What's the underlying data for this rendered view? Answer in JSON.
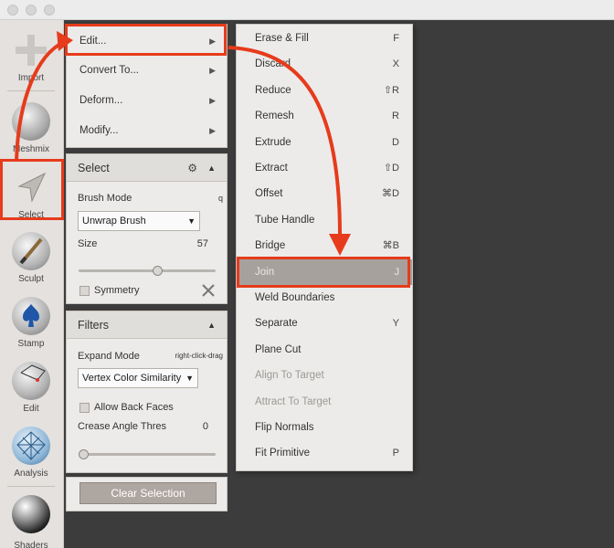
{
  "toolbar": {
    "tools": [
      {
        "label": "Import",
        "icon": "plus-icon"
      },
      {
        "label": "Meshmix",
        "icon": "meshmix-bust-icon"
      },
      {
        "label": "Select",
        "icon": "select-arrow-icon"
      },
      {
        "label": "Sculpt",
        "icon": "sculpt-brush-icon"
      },
      {
        "label": "Stamp",
        "icon": "stamp-icon"
      },
      {
        "label": "Edit",
        "icon": "edit-sphere-icon"
      },
      {
        "label": "Analysis",
        "icon": "analysis-mesh-icon"
      },
      {
        "label": "Shaders",
        "icon": "shaders-sphere-icon"
      }
    ]
  },
  "main_menu": {
    "items": [
      {
        "label": "Edit..."
      },
      {
        "label": "Convert To..."
      },
      {
        "label": "Deform..."
      },
      {
        "label": "Modify..."
      }
    ]
  },
  "select_panel": {
    "title": "Select",
    "brush_mode_label": "Brush Mode",
    "brush_mode_hint": "q",
    "brush_mode_value": "Unwrap Brush",
    "size_label": "Size",
    "size_value": "57",
    "size_fraction": 0.57,
    "symmetry_label": "Symmetry"
  },
  "filters_panel": {
    "title": "Filters",
    "expand_mode_label": "Expand Mode",
    "expand_mode_hint": "right-click-drag",
    "expand_mode_value": "Vertex Color Similarity",
    "allow_back_faces_label": "Allow Back Faces",
    "crease_label": "Crease Angle Thres",
    "crease_value": "0",
    "crease_fraction": 0.0
  },
  "clear_selection_label": "Clear Selection",
  "edit_submenu": {
    "items": [
      {
        "label": "Erase & Fill",
        "shortcut": "F",
        "state": "normal"
      },
      {
        "label": "Discard",
        "shortcut": "X",
        "state": "normal"
      },
      {
        "label": "Reduce",
        "shortcut": "⇧R",
        "state": "normal"
      },
      {
        "label": "Remesh",
        "shortcut": "R",
        "state": "normal"
      },
      {
        "label": "Extrude",
        "shortcut": "D",
        "state": "normal"
      },
      {
        "label": "Extract",
        "shortcut": "⇧D",
        "state": "normal"
      },
      {
        "label": "Offset",
        "shortcut": "⌘D",
        "state": "normal"
      },
      {
        "label": "Tube Handle",
        "shortcut": "",
        "state": "normal"
      },
      {
        "label": "Bridge",
        "shortcut": "⌘B",
        "state": "normal"
      },
      {
        "label": "Join",
        "shortcut": "J",
        "state": "active"
      },
      {
        "label": "Weld Boundaries",
        "shortcut": "",
        "state": "normal"
      },
      {
        "label": "Separate",
        "shortcut": "Y",
        "state": "normal"
      },
      {
        "label": "Plane Cut",
        "shortcut": "",
        "state": "normal"
      },
      {
        "label": "Align To Target",
        "shortcut": "",
        "state": "disabled"
      },
      {
        "label": "Attract To Target",
        "shortcut": "",
        "state": "disabled"
      },
      {
        "label": "Flip Normals",
        "shortcut": "",
        "state": "normal"
      },
      {
        "label": "Fit Primitive",
        "shortcut": "P",
        "state": "normal"
      }
    ]
  },
  "colors": {
    "highlight": "#e63b1c",
    "panel": "#ecebe9",
    "viewport": "#3c3c3c",
    "active_row": "#a6a19c"
  }
}
